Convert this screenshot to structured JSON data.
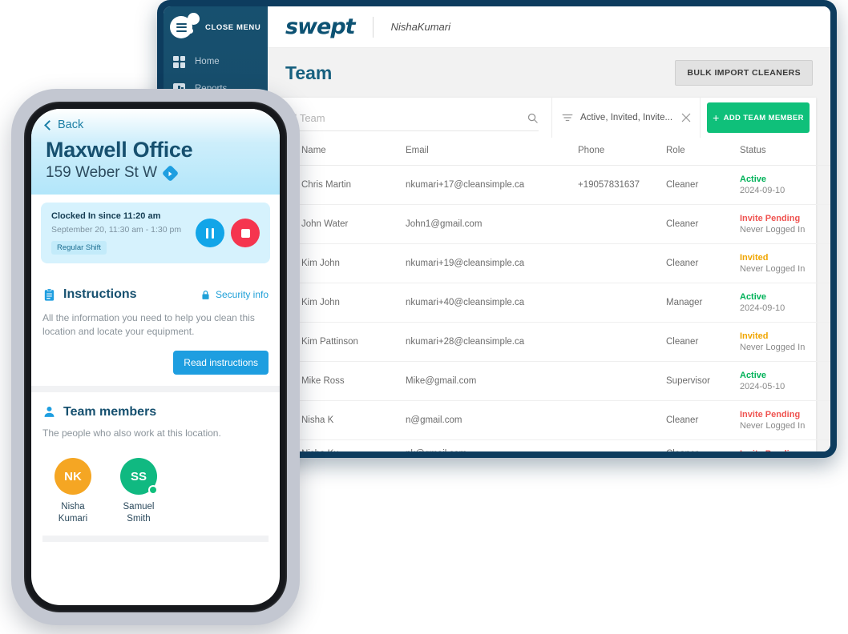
{
  "desktop": {
    "sidebar": {
      "menu_toggle_icon": "hamburger-icon",
      "close_menu_label": "CLOSE MENU",
      "items": [
        {
          "label": "Home",
          "icon": "grid-icon"
        },
        {
          "label": "Reports",
          "icon": "bar-chart-icon"
        }
      ]
    },
    "topbar": {
      "brand": "swept",
      "user_name": "NishaKumari"
    },
    "page": {
      "title": "Team",
      "bulk_import_label": "BULK IMPORT CLEANERS"
    },
    "toolbar": {
      "search_placeholder": "All Team",
      "search_value": "",
      "search_icon": "search-icon",
      "filter_icon": "filter-icon",
      "filter_value": "Active, Invited, Invite...",
      "clear_filter_icon": "close-icon",
      "add_member_label": "ADD TEAM MEMBER",
      "add_member_icon": "plus-icon"
    },
    "table": {
      "columns": [
        "Name",
        "Email",
        "Phone",
        "Role",
        "Status"
      ],
      "rows": [
        {
          "name": "Chris Martin",
          "email": "nkumari+17@cleansimple.ca",
          "phone": "+19057831637",
          "role": "Cleaner",
          "status": "Active",
          "status_kind": "active",
          "status_sub": "2024-09-10"
        },
        {
          "name": "John Water",
          "email": "John1@gmail.com",
          "phone": "",
          "role": "Cleaner",
          "status": "Invite Pending",
          "status_kind": "pending",
          "status_sub": "Never Logged In"
        },
        {
          "name": "Kim John",
          "email": "nkumari+19@cleansimple.ca",
          "phone": "",
          "role": "Cleaner",
          "status": "Invited",
          "status_kind": "invited",
          "status_sub": "Never Logged In"
        },
        {
          "name": "Kim John",
          "email": "nkumari+40@cleansimple.ca",
          "phone": "",
          "role": "Manager",
          "status": "Active",
          "status_kind": "active",
          "status_sub": "2024-09-10"
        },
        {
          "name": "Kim Pattinson",
          "email": "nkumari+28@cleansimple.ca",
          "phone": "",
          "role": "Cleaner",
          "status": "Invited",
          "status_kind": "invited",
          "status_sub": "Never Logged In"
        },
        {
          "name": "Mike Ross",
          "email": "Mike@gmail.com",
          "phone": "",
          "role": "Supervisor",
          "status": "Active",
          "status_kind": "active",
          "status_sub": "2024-05-10"
        },
        {
          "name": "Nisha K",
          "email": "n@gmail.com",
          "phone": "",
          "role": "Cleaner",
          "status": "Invite Pending",
          "status_kind": "pending",
          "status_sub": "Never Logged In"
        },
        {
          "name": "Nisha Ku",
          "email": "nk@gmail.com",
          "phone": "",
          "role": "Cleaner",
          "status": "Invite Pending",
          "status_kind": "pending",
          "status_sub": ""
        }
      ],
      "row_menu_icon": "kebab-menu-icon",
      "checkbox_icon": "checkbox-icon"
    }
  },
  "mobile": {
    "back_label": "Back",
    "back_icon": "chevron-left-icon",
    "location_title": "Maxwell Office",
    "location_address": "159 Weber St W",
    "directions_icon": "navigation-icon",
    "shift": {
      "clocked_in_text": "Clocked In since 11:20 am",
      "schedule_text": "September 20, 11:30 am - 1:30 pm",
      "shift_badge": "Regular Shift",
      "pause_icon": "pause-icon",
      "stop_icon": "stop-icon"
    },
    "instructions": {
      "icon": "clipboard-icon",
      "title": "Instructions",
      "security_link": "Security info",
      "security_icon": "lock-icon",
      "body": "All the information you need to help you clean this location and locate your equipment.",
      "button_label": "Read instructions"
    },
    "team_members": {
      "icon": "person-icon",
      "title": "Team members",
      "subtitle": "The people who also work at this location.",
      "members": [
        {
          "initials": "NK",
          "name": "Nisha Kumari",
          "color": "#f5a623",
          "online": false
        },
        {
          "initials": "SS",
          "name": "Samuel Smith",
          "color": "#10b981",
          "online": true
        }
      ]
    }
  },
  "colors": {
    "brand_navy": "#0d3c5e",
    "brand_teal": "#17607f",
    "accent_green": "#0fc07a",
    "status_active": "#00b259",
    "status_pending": "#ef5350",
    "status_invited": "#f0a500",
    "mobile_blue": "#1e9ee0",
    "mobile_red": "#f5354f"
  }
}
